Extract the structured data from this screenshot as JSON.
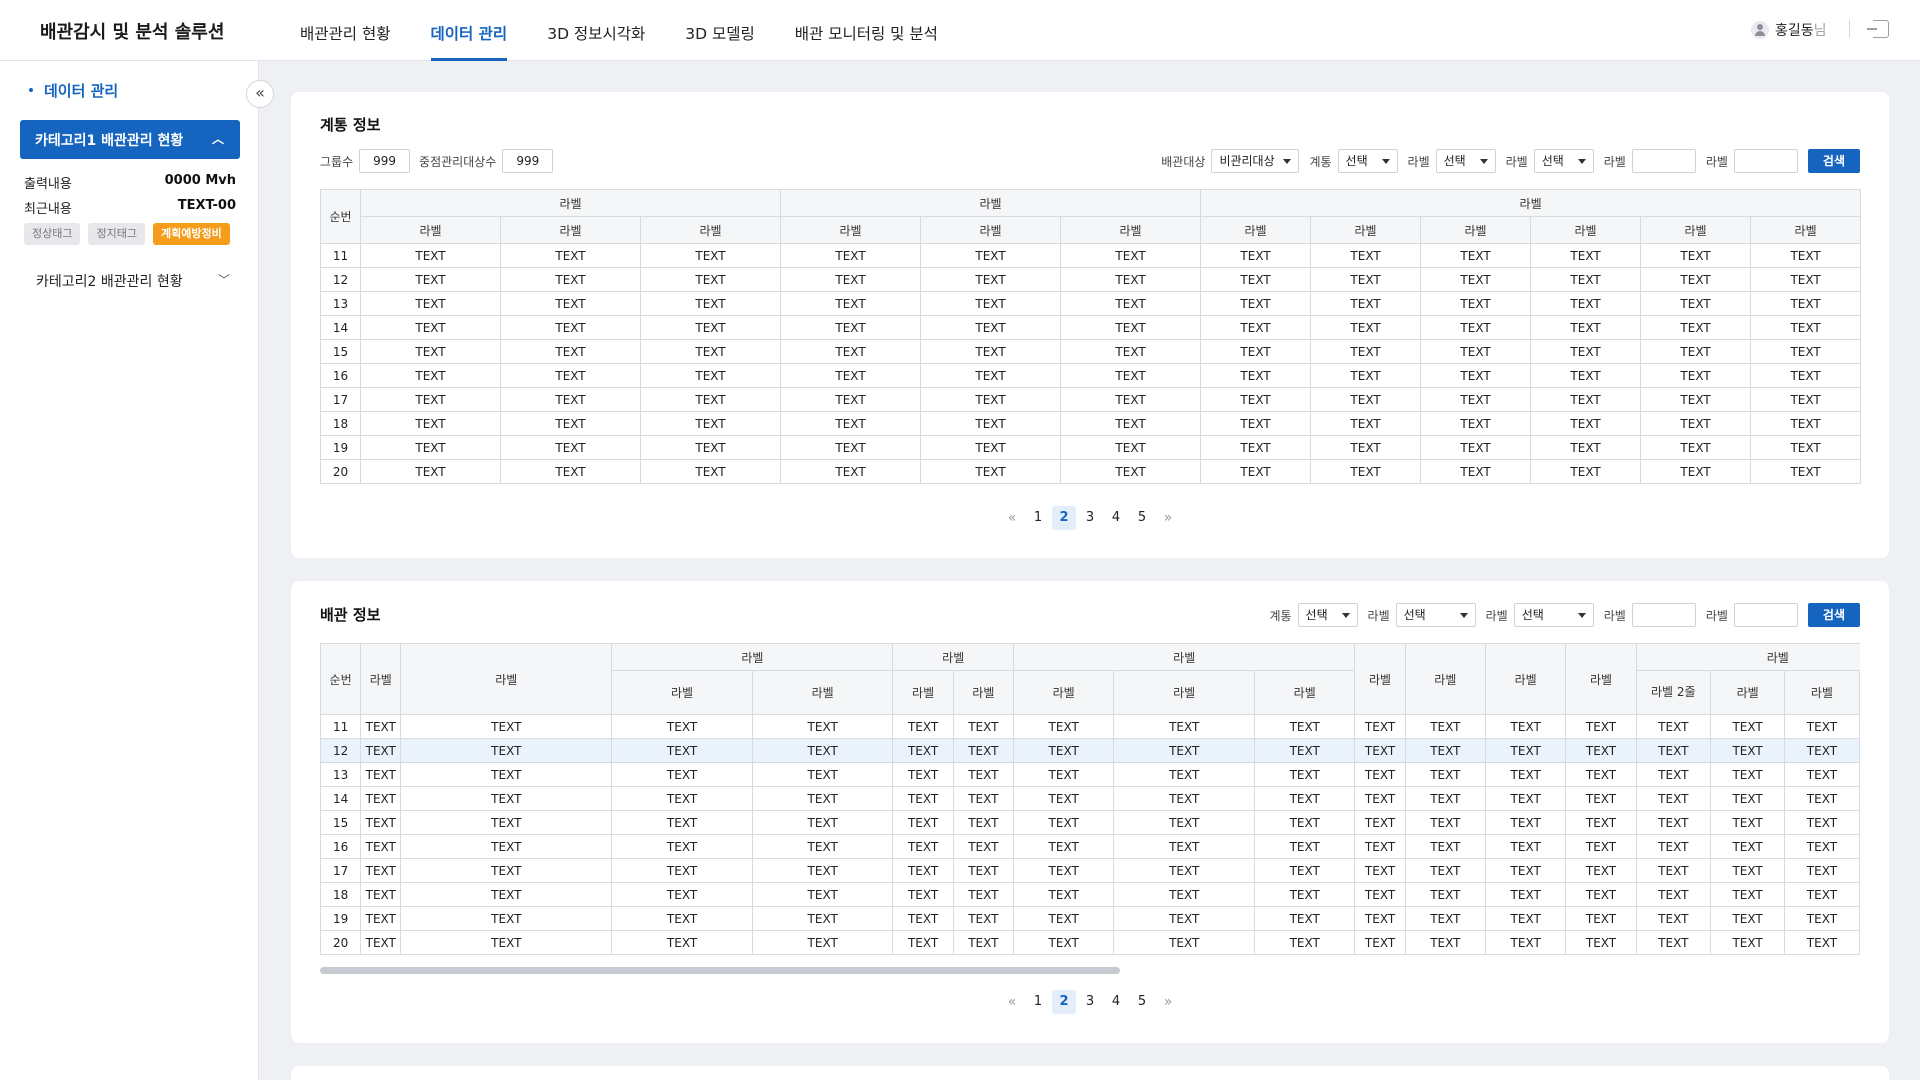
{
  "app": {
    "title": "배관감시 및 분석 솔루션"
  },
  "nav": [
    "배관관리 현황",
    "데이터 관리",
    "3D 정보시각화",
    "3D 모델링",
    "배관 모니터링 및 분석"
  ],
  "nav_active": 1,
  "user": {
    "name": "홍길동",
    "suffix": "님"
  },
  "sidebar": {
    "title": "데이터 관리",
    "collapse_icon": "«",
    "cat1": {
      "label": "카테고리1 배관관리 현황",
      "chev": "︿"
    },
    "rows": [
      {
        "k": "출력내용",
        "v": "0000 Mvh"
      },
      {
        "k": "최근내용",
        "v": "TEXT-00"
      }
    ],
    "tags": [
      "정상태그",
      "정지태그",
      "계획예방정비"
    ],
    "cat2": {
      "label": "카테고리2 배관관리 현황",
      "chev": "﹀"
    }
  },
  "panel1": {
    "title": "계통 정보",
    "counts": [
      {
        "label": "그룹수",
        "value": "999"
      },
      {
        "label": "중점관리대상수",
        "value": "999"
      }
    ],
    "filters": {
      "f1": {
        "label": "배관대상",
        "value": "비관리대상"
      },
      "f2": {
        "label": "계통",
        "value": "선택"
      },
      "f3": {
        "label": "라벨",
        "value": "선택"
      },
      "f4": {
        "label": "라벨",
        "value": "선택"
      },
      "f5": {
        "label": "라벨"
      },
      "f6": {
        "label": "라벨"
      },
      "search": "검색"
    },
    "table": {
      "no_header": "순번",
      "group_label": "라벨",
      "sub_label": "라벨",
      "cell": "TEXT",
      "rows": [
        "11",
        "12",
        "13",
        "14",
        "15",
        "16",
        "17",
        "18",
        "19",
        "20"
      ]
    },
    "pager": {
      "prev": "«",
      "next": "»",
      "pages": [
        "1",
        "2",
        "3",
        "4",
        "5"
      ],
      "active": 1
    }
  },
  "panel2": {
    "title": "배관 정보",
    "filters": {
      "f1": {
        "label": "계통",
        "value": "선택"
      },
      "f2": {
        "label": "라벨",
        "value": "선택"
      },
      "f3": {
        "label": "라벨",
        "value": "선택"
      },
      "f4": {
        "label": "라벨"
      },
      "f5": {
        "label": "라벨"
      },
      "search": "검색"
    },
    "table": {
      "no_header": "순번",
      "label": "라벨",
      "label_2line": "라벨 2줄",
      "cell": "TEXT",
      "rows": [
        "11",
        "12",
        "13",
        "14",
        "15",
        "16",
        "17",
        "18",
        "19",
        "20"
      ],
      "highlight_row": "12"
    },
    "pager": {
      "prev": "«",
      "next": "»",
      "pages": [
        "1",
        "2",
        "3",
        "4",
        "5"
      ],
      "active": 1
    }
  }
}
